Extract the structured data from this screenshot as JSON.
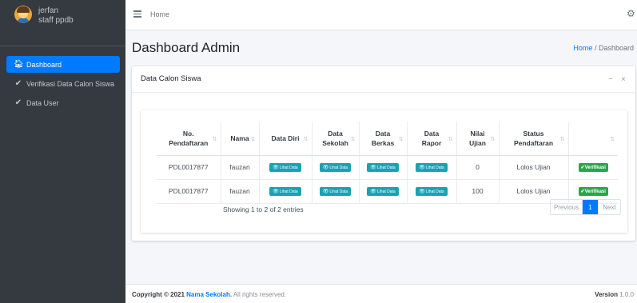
{
  "user": {
    "name": "jerfan",
    "role": "staff ppdb"
  },
  "sidebar": {
    "items": [
      {
        "icon": "home-icon",
        "label": "Dashboard",
        "active": true
      },
      {
        "icon": "check-icon",
        "label": "Verifikasi Data Calon Siswa",
        "active": false
      },
      {
        "icon": "check-icon",
        "label": "Data User",
        "active": false
      }
    ]
  },
  "navbar": {
    "home_label": "Home"
  },
  "header": {
    "title": "Dashboard Admin",
    "breadcrumb_home": "Home",
    "breadcrumb_separator": "/",
    "breadcrumb_current": "Dashboard"
  },
  "card": {
    "title": "Data Calon Siswa",
    "collapse": "−",
    "close": "×"
  },
  "table": {
    "columns": [
      {
        "line1": "No.",
        "line2": "Pendaftaran"
      },
      {
        "line1": "Nama",
        "line2": ""
      },
      {
        "line1": "Data Diri",
        "line2": ""
      },
      {
        "line1": "Data",
        "line2": "Sekolah"
      },
      {
        "line1": "Data",
        "line2": "Berkas"
      },
      {
        "line1": "Data",
        "line2": "Rapor"
      },
      {
        "line1": "Nilai",
        "line2": "Ujian"
      },
      {
        "line1": "Status",
        "line2": "Pendaftaran"
      },
      {
        "line1": "",
        "line2": ""
      }
    ],
    "view_button_label": "Lihat Data",
    "verify_button_label": "✔Verifikasi",
    "rows": [
      {
        "no": "PDL0017877",
        "nama": "fauzan",
        "nilai": "0",
        "status": "Lolos Ujian"
      },
      {
        "no": "PDL0017877",
        "nama": "fauzan",
        "nilai": "100",
        "status": "Lolos Ujian"
      }
    ]
  },
  "pagination": {
    "info": "Showing 1 to 2 of 2 entries",
    "previous": "Previous",
    "page": "1",
    "next": "Next"
  },
  "footer": {
    "prefix": "Copyright © 2021 ",
    "brand": "Nama Sekolah.",
    "suffix": " All rights reserved.",
    "version_label": "Version",
    "version": "1.0.0"
  },
  "colors": {
    "sidebar": "#343a40",
    "primary": "#007bff",
    "info": "#17a2b8",
    "success": "#28a745"
  }
}
